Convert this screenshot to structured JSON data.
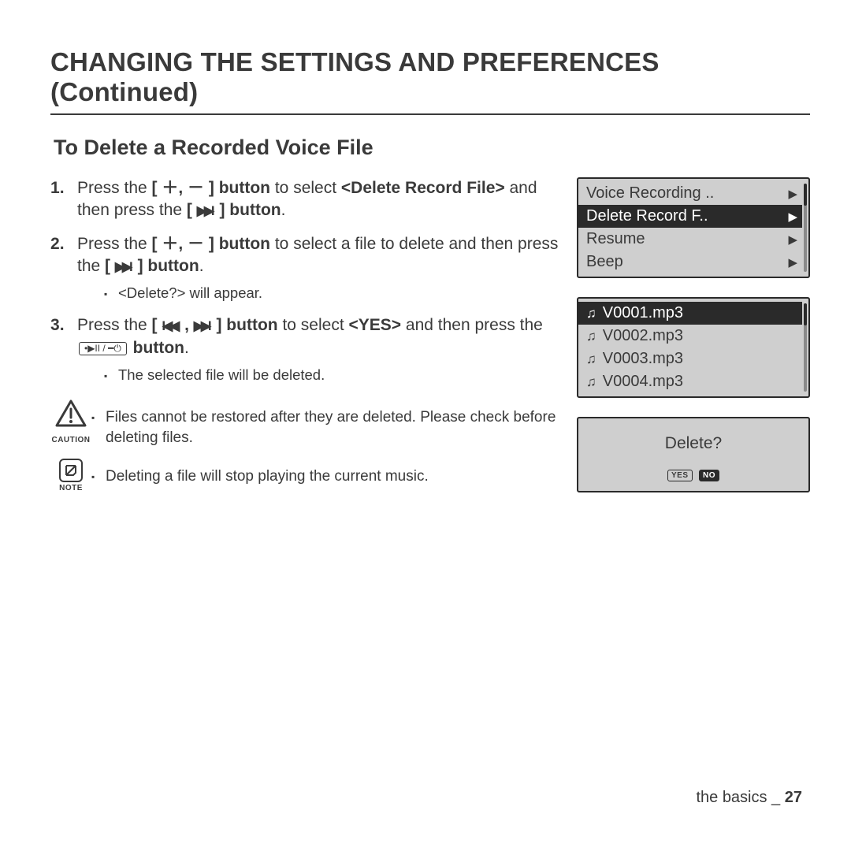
{
  "title": "CHANGING THE SETTINGS AND PREFERENCES (Continued)",
  "subtitle": "To Delete a Recorded Voice File",
  "steps": {
    "s1a": "Press the ",
    "s1b": "[ ＋, － ] button",
    "s1c": " to select ",
    "s1d": "<Delete Record File>",
    "s1e": " and then press the ",
    "s1f": "] button",
    "s2a": "Press the ",
    "s2b": "[ ＋, － ] button",
    "s2c": " to select a file to delete and then press the ",
    "s2d": "] button",
    "s2sub": "<Delete?> will appear.",
    "s3a": "Press the ",
    "s3b": "] button",
    "s3c": " to select ",
    "s3d": "<YES>",
    "s3e": " and then press the ",
    "s3f": " button",
    "s3sub": "The selected file will be deleted.",
    "play_glyphs": "•▶II / ━⏻"
  },
  "caution": {
    "label": "CAUTION",
    "text": "Files cannot be restored after they are deleted. Please check before deleting files."
  },
  "note": {
    "label": "NOTE",
    "text": "Deleting a file will stop playing the current music."
  },
  "screen1": {
    "items": [
      {
        "label": "Voice Recording ..",
        "selected": false
      },
      {
        "label": "Delete Record F..",
        "selected": true
      },
      {
        "label": "Resume",
        "selected": false
      },
      {
        "label": "Beep",
        "selected": false
      }
    ]
  },
  "screen2": {
    "items": [
      {
        "label": "V0001.mp3",
        "selected": true
      },
      {
        "label": "V0002.mp3",
        "selected": false
      },
      {
        "label": "V0003.mp3",
        "selected": false
      },
      {
        "label": "V0004.mp3",
        "selected": false
      }
    ]
  },
  "screen3": {
    "question": "Delete?",
    "yes": "YES",
    "no": "NO"
  },
  "footer": {
    "section": "the basics _",
    "page": "27"
  }
}
